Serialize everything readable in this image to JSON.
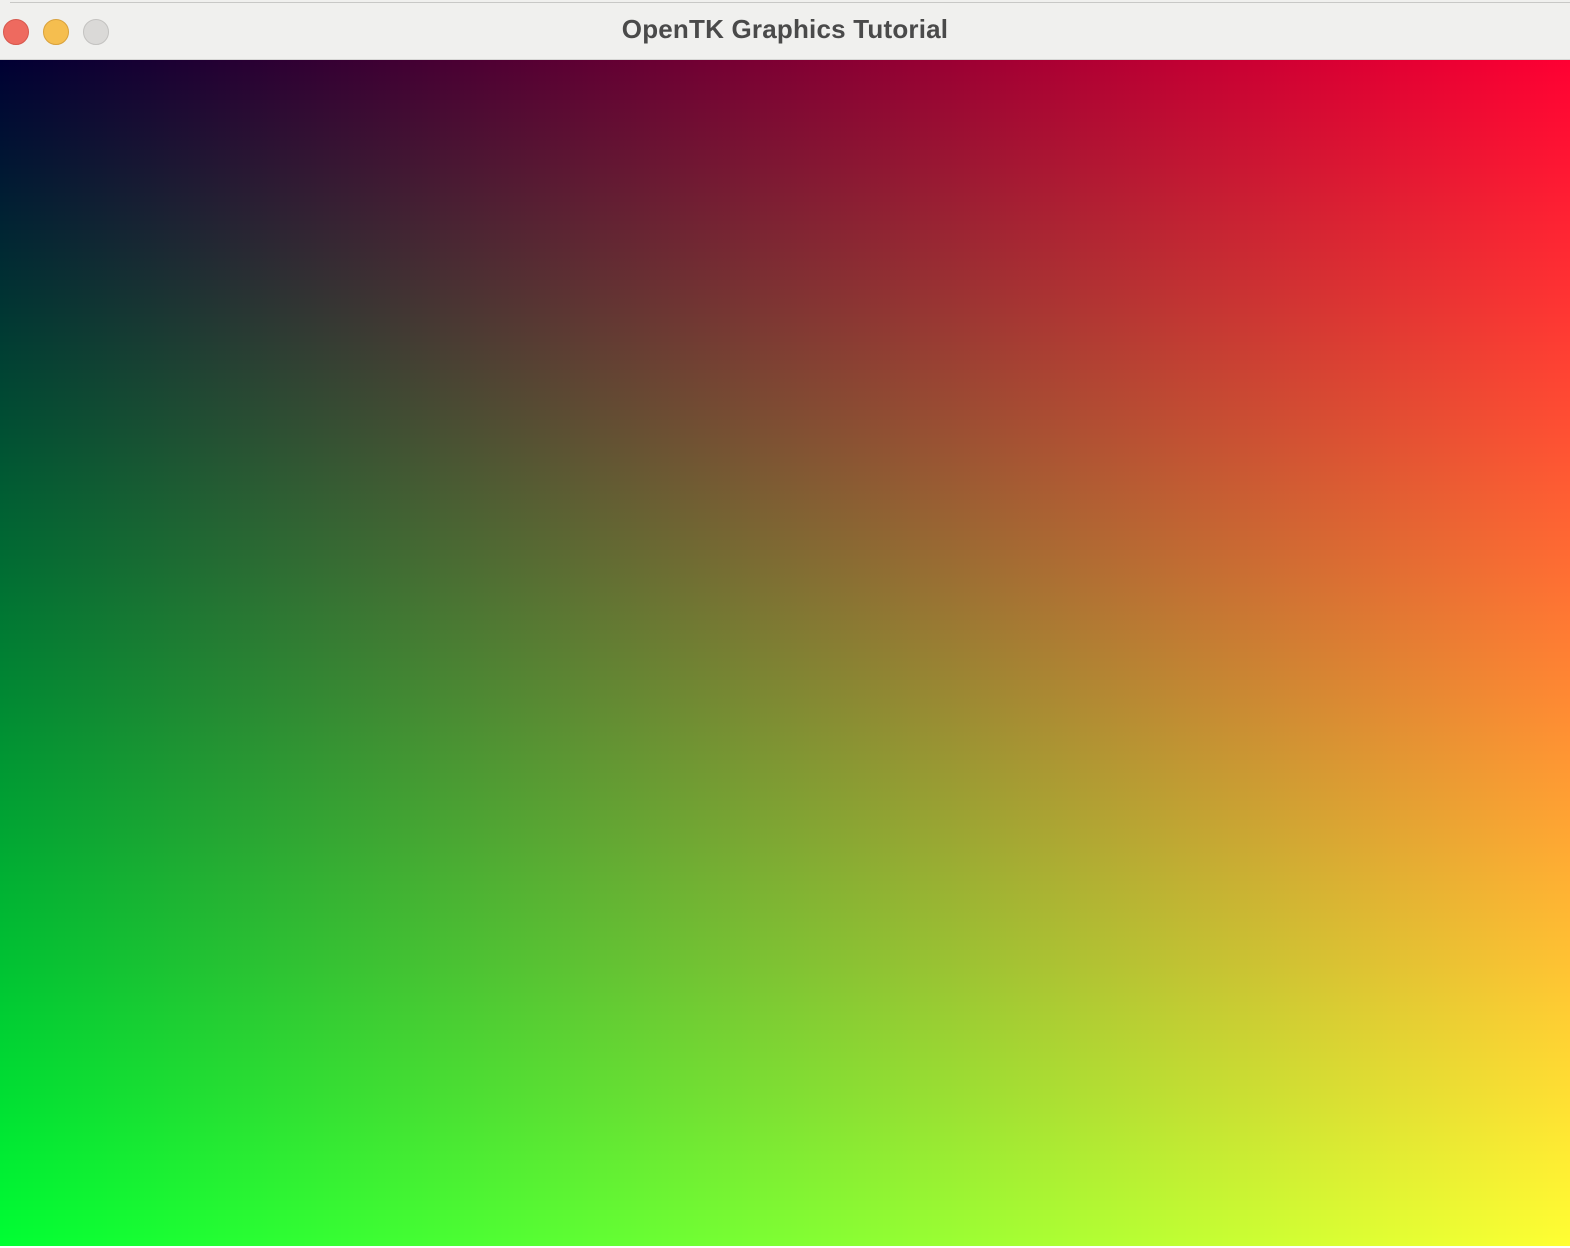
{
  "window": {
    "title": "OpenTK Graphics Tutorial",
    "controls": {
      "close_color": "#ee6a5f",
      "minimize_color": "#f5be4f",
      "zoom_color": "#dad9d7"
    }
  },
  "viewport": {
    "content": "gradient-quad",
    "corner_colors": {
      "top_left": "#000033",
      "top_right": "#ff0033",
      "bottom_left": "#00ff33",
      "bottom_right": "#ffff33"
    }
  }
}
